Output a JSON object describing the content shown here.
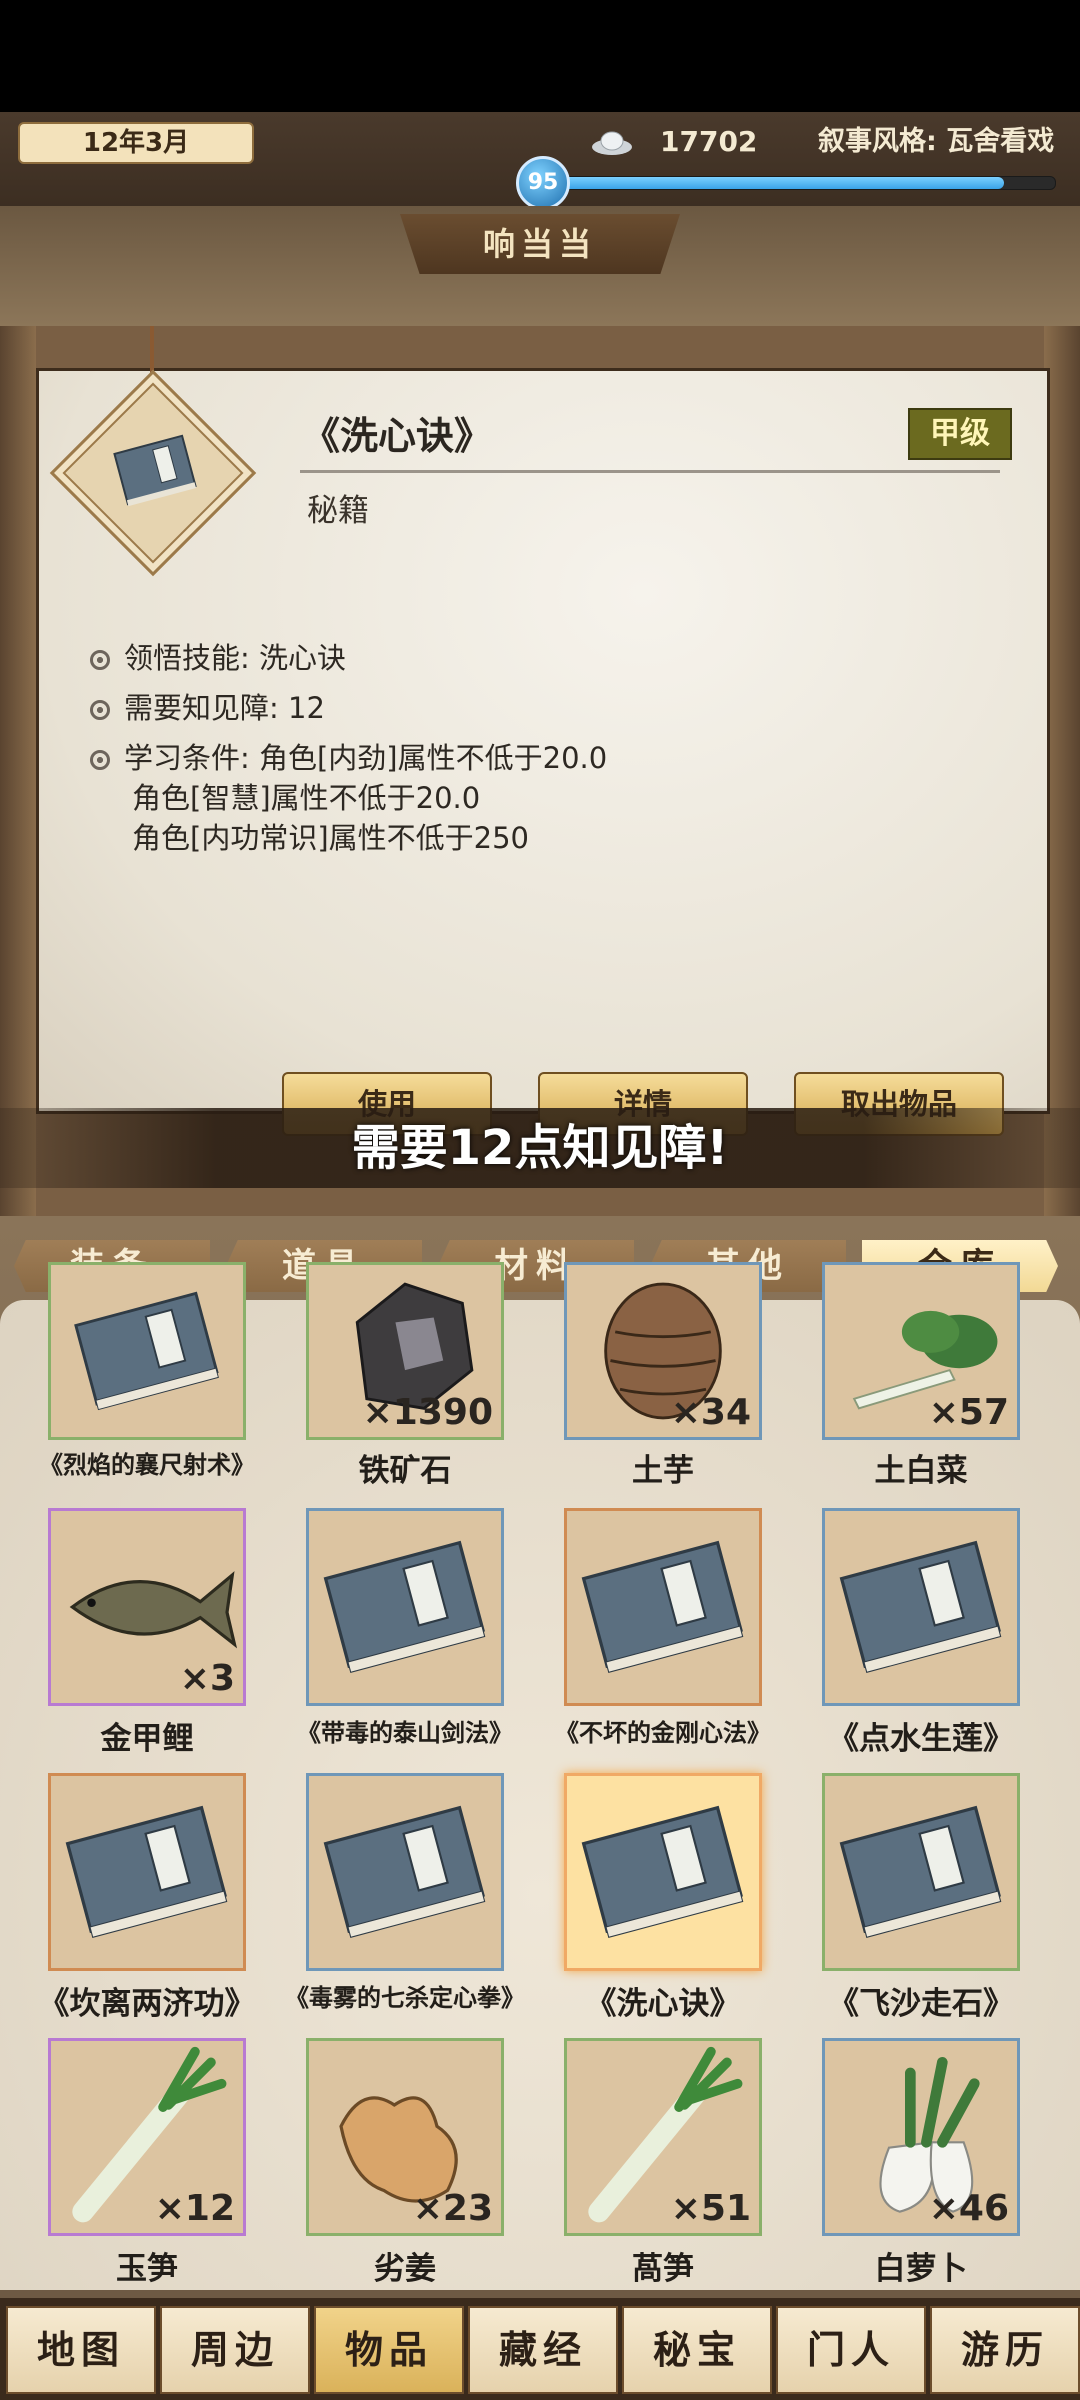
{
  "top": {
    "date": "12年3月",
    "money": "17702",
    "narrative_style": "叙事风格: 瓦舍看戏",
    "level": "95",
    "xp_fraction": 0.9
  },
  "title": "响当当",
  "item": {
    "name": "《洗心诀》",
    "grade": "甲级",
    "type": "秘籍",
    "attrs": [
      "领悟技能: 洗心诀",
      "需要知见障: 12",
      "学习条件: 角色[内劲]属性不低于20.0"
    ],
    "extra_lines": [
      "角色[智慧]属性不低于20.0",
      "角色[内功常识]属性不低于250"
    ]
  },
  "buttons": {
    "use": "使用",
    "detail": "详情",
    "take_out": "取出物品"
  },
  "toast": "需要12点知见障!",
  "tabs": [
    "装备",
    "道具",
    "材料",
    "其他",
    "仓库"
  ],
  "grid": [
    {
      "name": "《烈焰的襄尺射术》",
      "qty": "",
      "icon": "book-icon"
    },
    {
      "name": "铁矿石",
      "qty": "×1390",
      "icon": "iron-ore-icon"
    },
    {
      "name": "土芋",
      "qty": "×34",
      "icon": "taro-icon"
    },
    {
      "name": "土白菜",
      "qty": "×57",
      "icon": "cabbage-icon"
    },
    {
      "name": "金甲鲤",
      "qty": "×3",
      "icon": "fish-icon"
    },
    {
      "name": "《带毒的泰山剑法》",
      "qty": "",
      "icon": "book-icon"
    },
    {
      "name": "《不坏的金刚心法》",
      "qty": "",
      "icon": "book-icon"
    },
    {
      "name": "《点水生莲》",
      "qty": "",
      "icon": "book-icon"
    },
    {
      "name": "《坎离两济功》",
      "qty": "",
      "icon": "book-icon"
    },
    {
      "name": "《毒雾的七杀定心拳》",
      "qty": "",
      "icon": "book-icon"
    },
    {
      "name": "《洗心诀》",
      "qty": "",
      "icon": "book-icon"
    },
    {
      "name": "《飞沙走石》",
      "qty": "",
      "icon": "book-icon"
    },
    {
      "name": "玉笋",
      "qty": "×12",
      "icon": "leek-icon"
    },
    {
      "name": "劣姜",
      "qty": "×23",
      "icon": "ginger-icon"
    },
    {
      "name": "萵笋",
      "qty": "×51",
      "icon": "leek-icon"
    },
    {
      "name": "白萝卜",
      "qty": "×46",
      "icon": "radish-icon"
    }
  ],
  "nav": [
    "地图",
    "周边",
    "物品",
    "藏经",
    "秘宝",
    "门人",
    "游历"
  ],
  "colors": {
    "accent": "#f2d995",
    "grade_bg": "#6b6a1f",
    "xp": "#3aa3e8"
  }
}
